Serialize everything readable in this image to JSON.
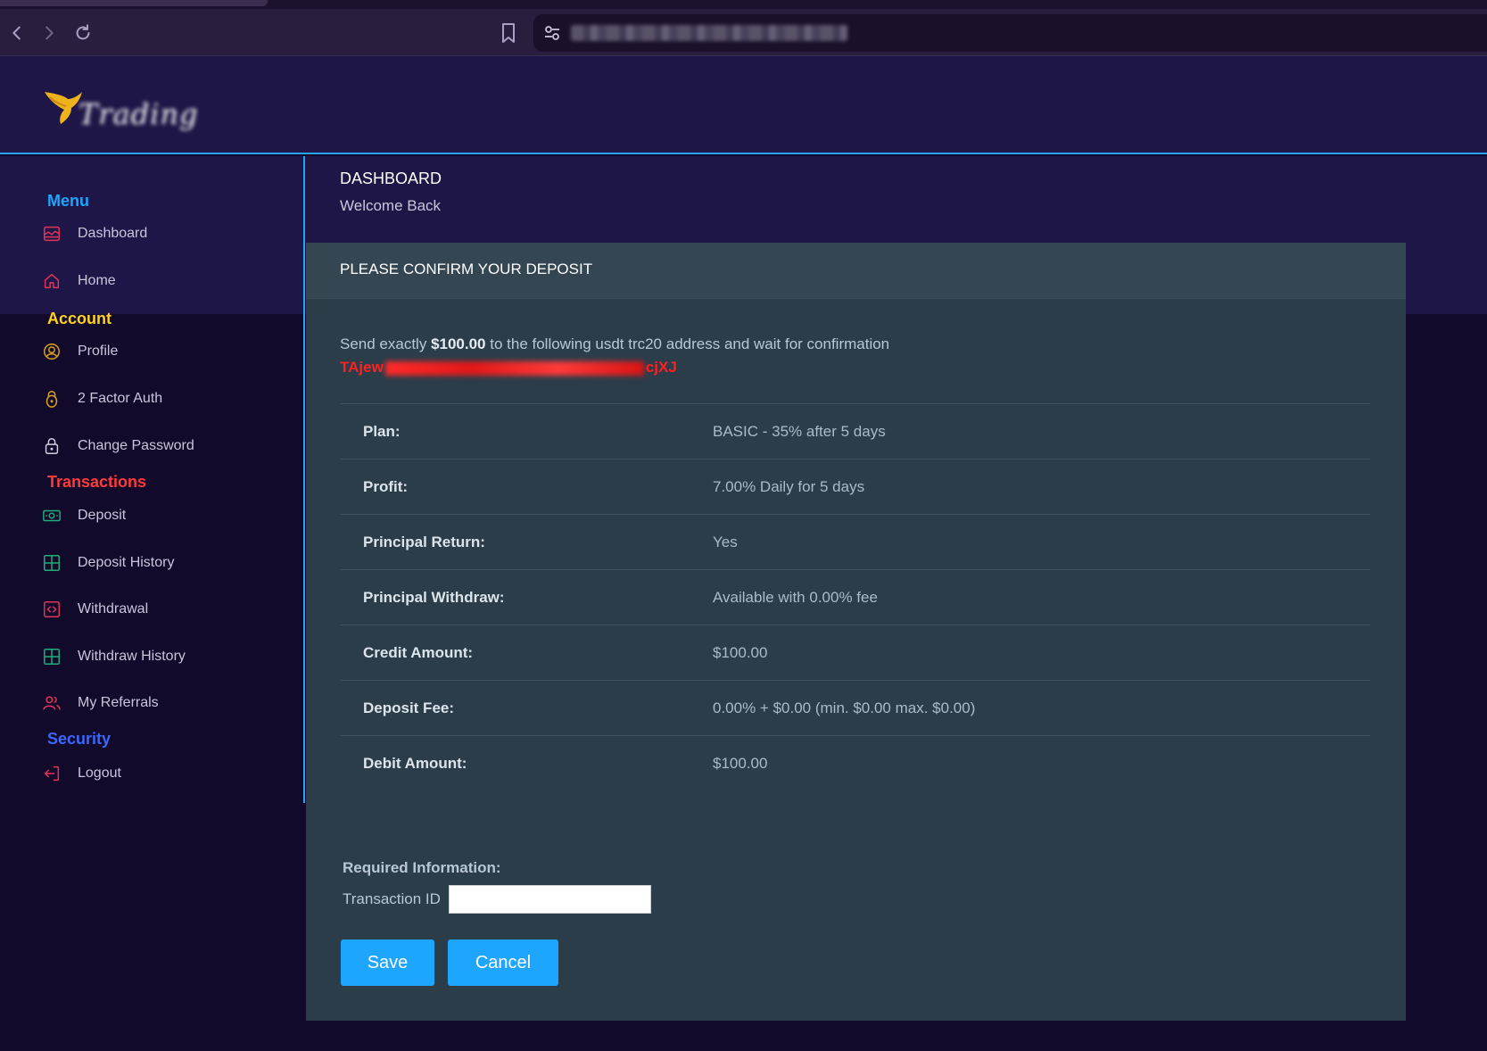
{
  "browser": {
    "icons": [
      "back-icon",
      "forward-icon",
      "reload-icon",
      "bookmark-icon",
      "site-settings-icon"
    ]
  },
  "header": {
    "logo_icon": "wing-logo"
  },
  "sidebar": {
    "sections": {
      "menu": {
        "title": "Menu",
        "color": "#1ea6ff"
      },
      "account": {
        "title": "Account",
        "color": "#ffd21e"
      },
      "transactions": {
        "title": "Transactions",
        "color": "#ff3a3a"
      },
      "security": {
        "title": "Security",
        "color": "#3b67ff"
      }
    },
    "items": [
      {
        "label": "Dashboard",
        "icon": "dashboard-icon"
      },
      {
        "label": "Home",
        "icon": "home-icon"
      },
      {
        "label": "Profile",
        "icon": "profile-icon"
      },
      {
        "label": "2 Factor Auth",
        "icon": "lock-key-icon"
      },
      {
        "label": "Change Password",
        "icon": "padlock-icon"
      },
      {
        "label": "Deposit",
        "icon": "cash-icon"
      },
      {
        "label": "Deposit History",
        "icon": "grid-icon"
      },
      {
        "label": "Withdrawal",
        "icon": "code-box-icon"
      },
      {
        "label": "Withdraw History",
        "icon": "grid-icon"
      },
      {
        "label": "My Referrals",
        "icon": "users-icon"
      },
      {
        "label": "Logout",
        "icon": "logout-icon"
      }
    ]
  },
  "main": {
    "title": "DASHBOARD",
    "subtitle": "Welcome Back"
  },
  "card": {
    "title": "PLEASE CONFIRM YOUR DEPOSIT",
    "send_prefix": "Send exactly ",
    "send_amount": "$100.00",
    "send_suffix": " to the following usdt trc20 address and wait for confirmation",
    "address_start": "TAjew",
    "address_end": "cjXJ",
    "rows": [
      {
        "key": "Plan:",
        "value": "BASIC - 35% after 5 days"
      },
      {
        "key": "Profit:",
        "value": "7.00% Daily for 5 days"
      },
      {
        "key": "Principal Return:",
        "value": "Yes"
      },
      {
        "key": "Principal Withdraw:",
        "value": "Available with 0.00% fee"
      },
      {
        "key": "Credit Amount:",
        "value": "$100.00"
      },
      {
        "key": "Deposit Fee:",
        "value": "0.00% + $0.00 (min. $0.00 max. $0.00)"
      },
      {
        "key": "Debit Amount:",
        "value": "$100.00"
      }
    ],
    "required_title": "Required Information:",
    "txid_label": "Transaction ID",
    "txid_value": "",
    "save_label": "Save",
    "cancel_label": "Cancel"
  }
}
